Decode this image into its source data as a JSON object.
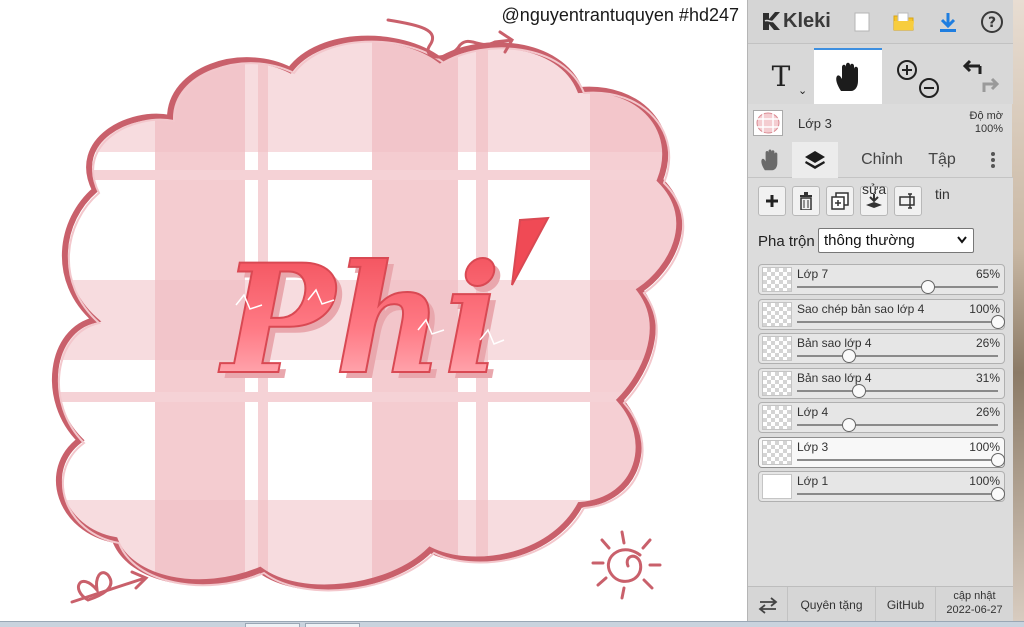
{
  "watermark": "@nguyentrantuquyen #hd247",
  "artwork": {
    "word": "Phi",
    "accent": "´"
  },
  "sidebar": {
    "logo_text": "Kleki",
    "top_buttons": [
      "new-file-icon",
      "folder-open-icon",
      "download-icon",
      "help-icon"
    ],
    "tools": {
      "text_glyph": "T",
      "caret": "⌄"
    },
    "current_layer": {
      "name": "Lớp 3",
      "opacity_label": "Độ mờ",
      "opacity_value": "100%"
    },
    "tabs": [
      "Chỉnh",
      "Tập"
    ],
    "layer_buttons_extra": [
      "sửa",
      "tin"
    ],
    "blend": {
      "label": "Pha trộn",
      "value": "thông thường"
    },
    "layers": [
      {
        "name": "Lớp 7",
        "opacity": "65%",
        "level": 0.65,
        "selected": false,
        "thumb": "checker"
      },
      {
        "name": "Sao chép bản sao lớp 4",
        "opacity": "100%",
        "level": 1.0,
        "selected": false,
        "thumb": "checker"
      },
      {
        "name": "Bản sao lớp 4",
        "opacity": "26%",
        "level": 0.26,
        "selected": false,
        "thumb": "checker"
      },
      {
        "name": "Bản sao lớp 4",
        "opacity": "31%",
        "level": 0.31,
        "selected": false,
        "thumb": "checker"
      },
      {
        "name": "Lớp 4",
        "opacity": "26%",
        "level": 0.26,
        "selected": false,
        "thumb": "checker"
      },
      {
        "name": "Lớp 3",
        "opacity": "100%",
        "level": 1.0,
        "selected": true,
        "thumb": "checker"
      },
      {
        "name": "Lớp 1",
        "opacity": "100%",
        "level": 1.0,
        "selected": false,
        "thumb": "plain"
      }
    ],
    "bottom": {
      "donate": "Quyên tặng",
      "github": "GitHub",
      "update_label": "cập nhật",
      "update_date": "2022-06-27"
    }
  },
  "colors": {
    "accent_blue": "#3d8fe0",
    "pink_frame": "#c9606b",
    "folder_yellow": "#f5c32a",
    "title_red": "#f05560"
  }
}
